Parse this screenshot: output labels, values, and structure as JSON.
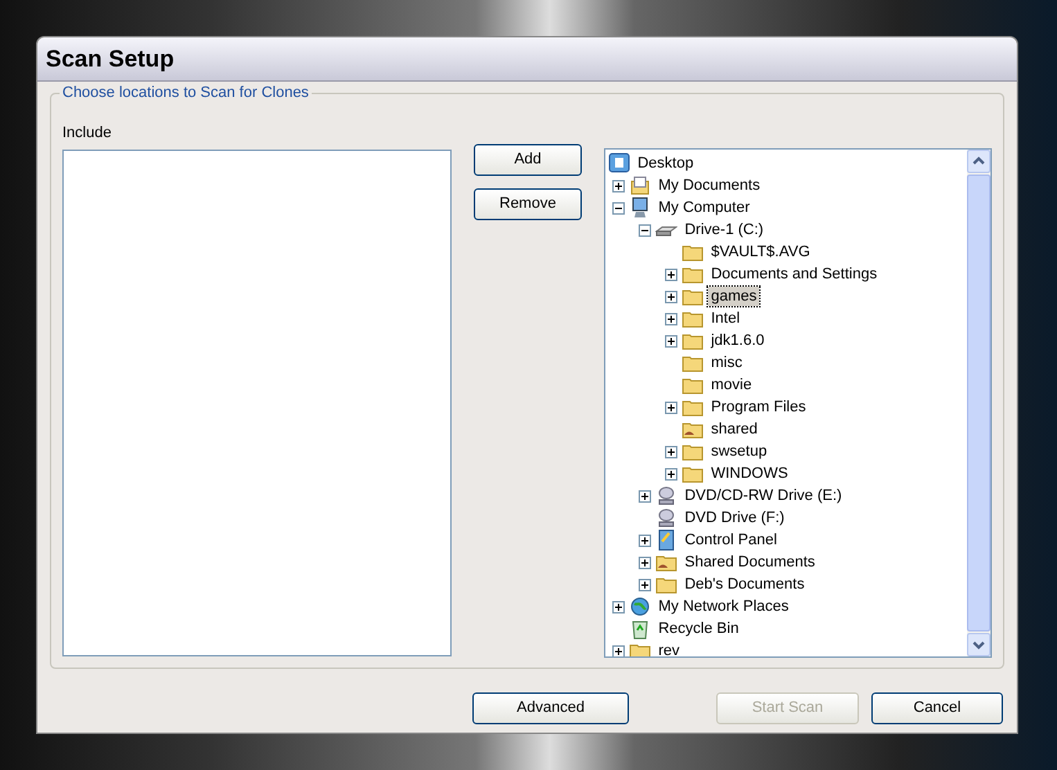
{
  "window": {
    "title": "Scan Setup"
  },
  "group": {
    "legend": "Choose locations to Scan for Clones",
    "include_label": "Include"
  },
  "side_buttons": [
    {
      "label": "Add",
      "disabled": false
    },
    {
      "label": "Remove",
      "disabled": false
    }
  ],
  "tree": [
    {
      "label": "Desktop",
      "kind": "desktop",
      "selected": false,
      "children": [
        {
          "label": "My Documents",
          "kind": "documents",
          "expanded": false,
          "selected": false
        },
        {
          "label": "My Computer",
          "kind": "computer",
          "expanded": true,
          "selected": false,
          "children": [
            {
              "label": "Drive-1 (C:)",
              "kind": "drive",
              "expanded": true,
              "selected": false,
              "children": [
                {
                  "label": "$VAULT$.AVG",
                  "kind": "folder",
                  "selected": false
                },
                {
                  "label": "Documents and Settings",
                  "kind": "folder",
                  "expanded": false,
                  "selected": false
                },
                {
                  "label": "games",
                  "kind": "folder",
                  "expanded": false,
                  "selected": true
                },
                {
                  "label": "Intel",
                  "kind": "folder",
                  "expanded": false,
                  "selected": false
                },
                {
                  "label": "jdk1.6.0",
                  "kind": "folder",
                  "expanded": false,
                  "selected": false
                },
                {
                  "label": "misc",
                  "kind": "folder",
                  "selected": false
                },
                {
                  "label": "movie",
                  "kind": "folder",
                  "selected": false
                },
                {
                  "label": "Program Files",
                  "kind": "folder",
                  "expanded": false,
                  "selected": false
                },
                {
                  "label": "shared",
                  "kind": "shared-folder",
                  "selected": false
                },
                {
                  "label": "swsetup",
                  "kind": "folder",
                  "expanded": false,
                  "selected": false
                },
                {
                  "label": "WINDOWS",
                  "kind": "folder",
                  "expanded": false,
                  "selected": false
                }
              ]
            },
            {
              "label": "DVD/CD-RW Drive (E:)",
              "kind": "cdrom",
              "expanded": false,
              "selected": false
            },
            {
              "label": "DVD Drive (F:)",
              "kind": "cdrom",
              "selected": false
            },
            {
              "label": "Control Panel",
              "kind": "control-panel",
              "expanded": false,
              "selected": false
            },
            {
              "label": "Shared Documents",
              "kind": "shared-folder",
              "expanded": false,
              "selected": false
            },
            {
              "label": "Deb's Documents",
              "kind": "folder",
              "expanded": false,
              "selected": false
            }
          ]
        },
        {
          "label": "My Network Places",
          "kind": "network",
          "expanded": false,
          "selected": false
        },
        {
          "label": "Recycle Bin",
          "kind": "recycle",
          "selected": false
        },
        {
          "label": "rev",
          "kind": "folder",
          "expanded": false,
          "selected": false
        }
      ]
    }
  ],
  "bottom_buttons": [
    {
      "label": "Advanced",
      "disabled": false
    },
    {
      "label": "Start Scan",
      "disabled": true
    },
    {
      "label": "Cancel",
      "disabled": false
    }
  ]
}
